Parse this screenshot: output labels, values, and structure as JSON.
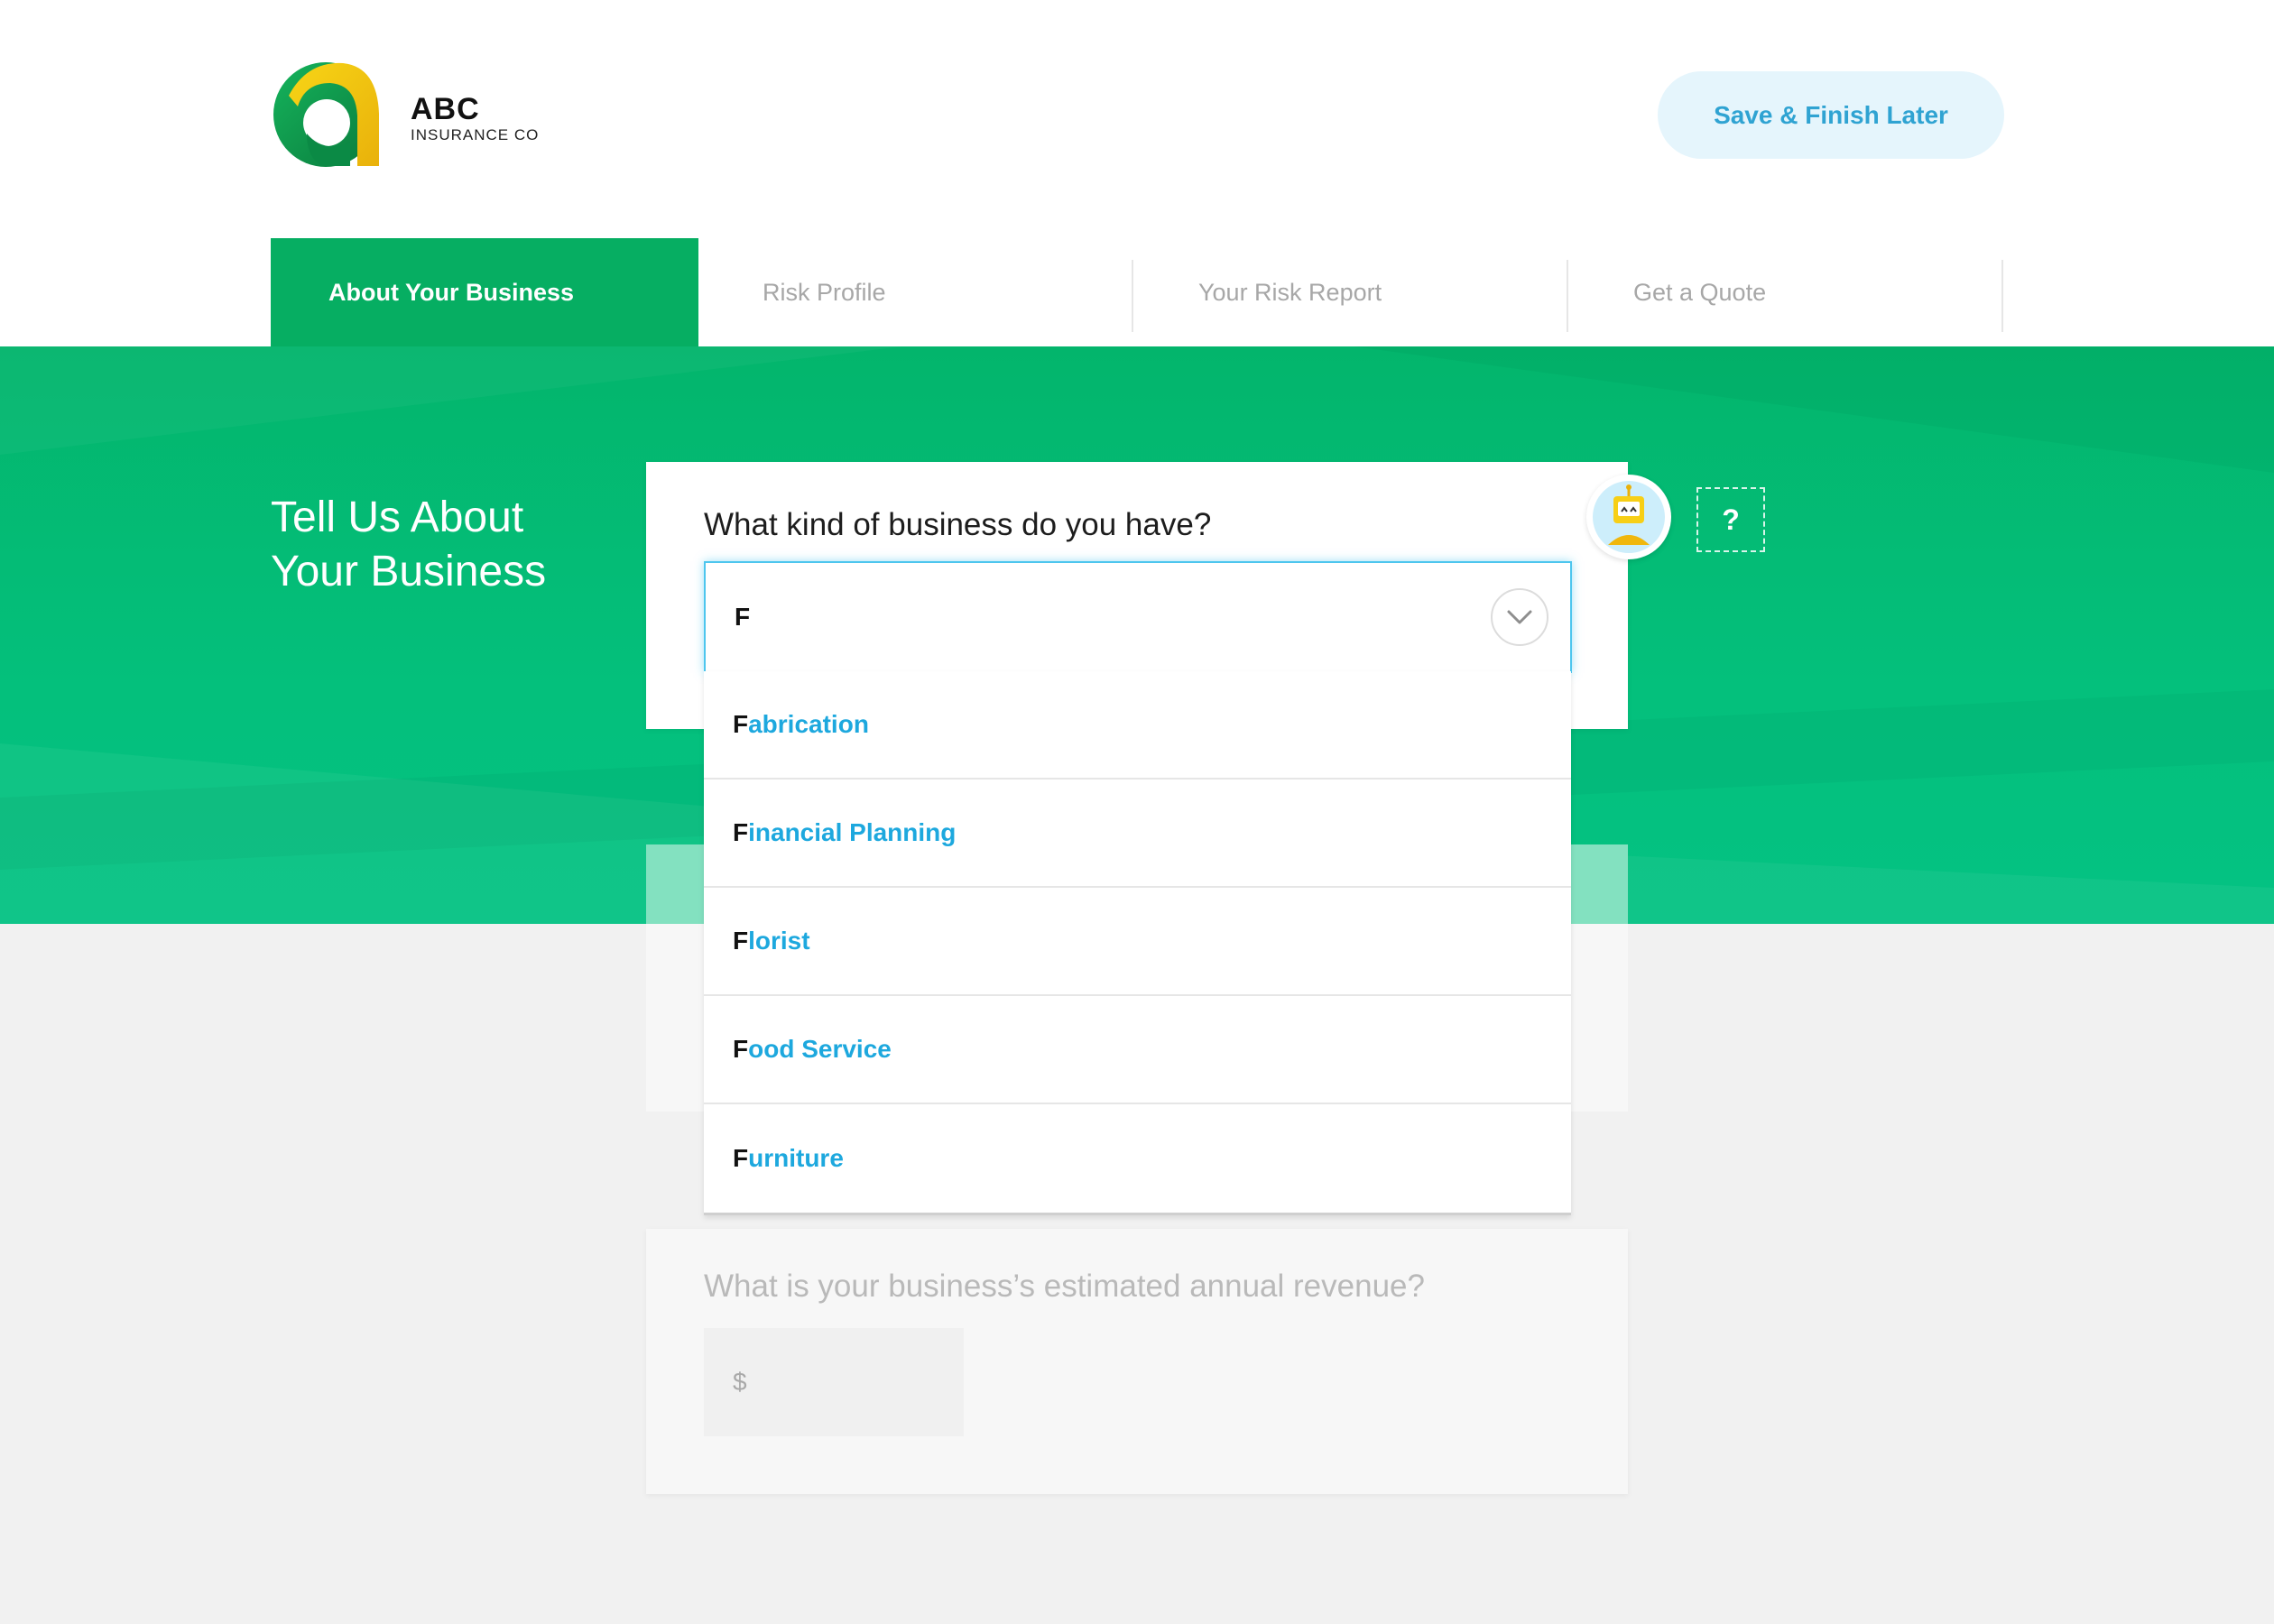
{
  "brand": {
    "name": "ABC",
    "subtitle": "INSURANCE CO"
  },
  "header": {
    "save_label": "Save & Finish Later"
  },
  "steps": [
    {
      "label": "About Your Business",
      "active": true
    },
    {
      "label": "Risk Profile",
      "active": false
    },
    {
      "label": "Your Risk Report",
      "active": false
    },
    {
      "label": "Get a Quote",
      "active": false
    }
  ],
  "hero": {
    "title_line1": "Tell Us About",
    "title_line2": "Your Business"
  },
  "business_question": {
    "label": "What kind of business do you have?",
    "value": "F",
    "options": [
      {
        "match": "F",
        "rest": "abrication"
      },
      {
        "match": "F",
        "rest": "inancial Planning"
      },
      {
        "match": "F",
        "rest": "lorist"
      },
      {
        "match": "F",
        "rest": "ood Service"
      },
      {
        "match": "F",
        "rest": "urniture"
      }
    ]
  },
  "revenue_question": {
    "label": "What is your business’s estimated annual revenue?",
    "prefix": "$"
  },
  "help": {
    "label": "?"
  },
  "colors": {
    "primary_green": "#06ae62",
    "accent_blue": "#1da8de",
    "save_button_bg": "#e5f5fc"
  },
  "icons": {
    "logo": "abc-logo",
    "dropdown": "chevron-down-icon",
    "assistant": "robot-icon",
    "help": "question-icon"
  }
}
